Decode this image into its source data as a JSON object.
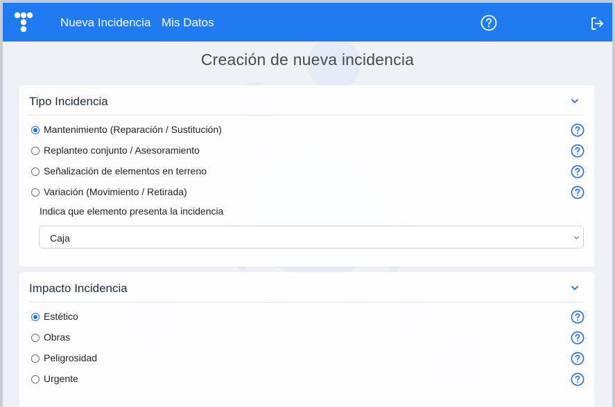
{
  "colors": {
    "navbar": "#1f7bf0",
    "accent": "#1f6fe0",
    "help_icon": "#1f6fe0",
    "page_bg": "#eef1f5"
  },
  "navbar": {
    "logo_icon": "brand-dots-logo",
    "links": [
      {
        "label": "Nueva Incidencia"
      },
      {
        "label": "Mis Datos"
      }
    ],
    "help_icon": "question-circle-icon",
    "logout_icon": "logout-icon"
  },
  "page": {
    "title": "Creación de nueva incidencia"
  },
  "tipo_incidencia": {
    "title": "Tipo Incidencia",
    "collapse_icon": "chevron-down-icon",
    "options": [
      {
        "label": "Mantenimiento (Reparación / Sustitución)",
        "checked": true
      },
      {
        "label": "Replanteo conjunto / Asesoramiento",
        "checked": false
      },
      {
        "label": "Señalización de elementos en terreno",
        "checked": false
      },
      {
        "label": "Variación (Movimiento / Retirada)",
        "checked": false
      }
    ],
    "element_label": "Indica que elemento presenta la incidencia",
    "element_select": {
      "value": "Caja"
    }
  },
  "impacto_incidencia": {
    "title": "Impacto Incidencia",
    "collapse_icon": "chevron-down-icon",
    "options": [
      {
        "label": "Estético",
        "checked": true
      },
      {
        "label": "Obras",
        "checked": false
      },
      {
        "label": "Peligrosidad",
        "checked": false
      },
      {
        "label": "Urgente",
        "checked": false
      }
    ]
  }
}
